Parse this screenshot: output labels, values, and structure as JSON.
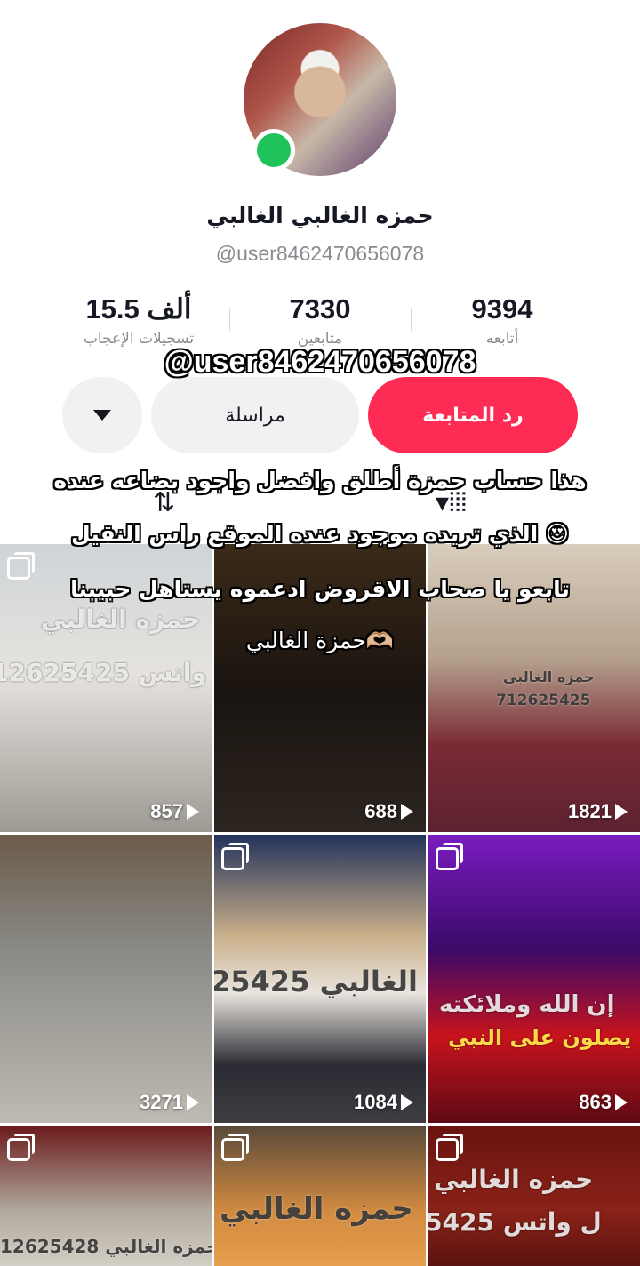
{
  "profile": {
    "display_name": "حمزه الغالبي الغالبي",
    "username": "@user8462470656078",
    "online_status": "online"
  },
  "stats": {
    "likes_value": "15.5 ألف",
    "likes_label": "تسجيلات الإعجاب",
    "followers_value": "7330",
    "followers_label": "متابعين",
    "following_value": "9394",
    "following_label": "أتابعه"
  },
  "overlay": {
    "username": "@user8462470656078",
    "caption_lines": [
      "هذا حساب حمزة أطلق وافضل واجود بضاعه عنده",
      "الذي تريده موجود عنده الموقع راس النقيل 😍",
      "تابعو يا صحاب الاقروض ادعموه يستاهل حبيبنا",
      "حمزة الغالبي🫶🏼"
    ]
  },
  "actions": {
    "follow_back_label": "رد المتابعة",
    "message_label": "مراسلة",
    "more_icon": "triangle-down-icon"
  },
  "tabs": {
    "repost_icon": "repost-icon",
    "videos_icon": "grid-icon"
  },
  "videos": [
    {
      "views": "857",
      "multi": true,
      "watermark": "حمزه الغالبي",
      "watermark2": "12625425 ل واتس"
    },
    {
      "views": "688",
      "multi": false,
      "watermark": "",
      "watermark2": ""
    },
    {
      "views": "1821",
      "multi": false,
      "watermark": "حمزه الغالبي",
      "watermark2": "712625425"
    },
    {
      "views": "3271",
      "multi": false,
      "watermark": "",
      "watermark2": ""
    },
    {
      "views": "1084",
      "multi": true,
      "watermark": "25425 ه الغالبي",
      "watermark2": ""
    },
    {
      "views": "863",
      "multi": true,
      "watermark": "إن الله وملائكته",
      "watermark2": "يصلون على النبي"
    },
    {
      "views": "",
      "multi": true,
      "watermark": "12625428 حمزه الغالبي",
      "watermark2": ""
    },
    {
      "views": "",
      "multi": true,
      "watermark": "حمزه الغالبي",
      "watermark2": ""
    },
    {
      "views": "",
      "multi": true,
      "watermark": "حمزه الغالبي",
      "watermark2": "5425 ل واتس"
    }
  ],
  "colors": {
    "accent": "#fe2c55",
    "online": "#20c35b",
    "secondary_text": "#8a8b91"
  }
}
